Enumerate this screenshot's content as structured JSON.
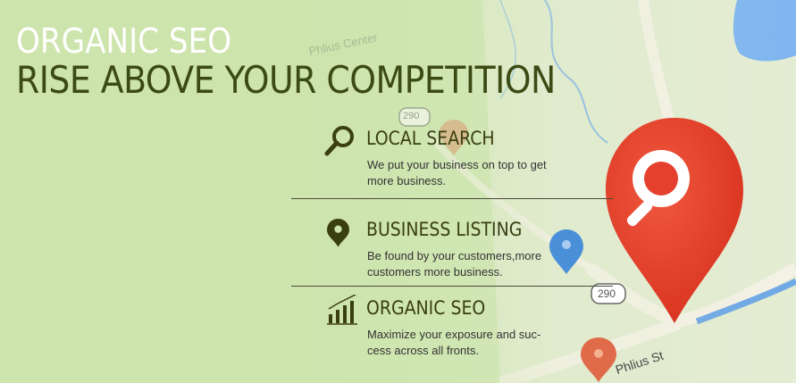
{
  "banner": {
    "title_line1": "ORGANIC SEO",
    "title_line2": "RISE ABOVE YOUR COMPETITION"
  },
  "features": [
    {
      "icon": "magnifier-icon",
      "title": "LOCAL SEARCH",
      "desc": "We put your business on top to get more business."
    },
    {
      "icon": "map-pin-icon",
      "title": "BUSINESS LISTING",
      "desc": "Be found by your customers,more customers more business."
    },
    {
      "icon": "bar-chart-icon",
      "title": "ORGANIC SEO",
      "desc": "Maximize your exposure and suc- cess across all fronts."
    }
  ],
  "map": {
    "road_shield_1": "290",
    "road_shield_2": "290",
    "street_fragment": "Phlius St",
    "place_fragment": "Phlius Center",
    "colors": {
      "bg_green": "#cfe6b0",
      "water": "#7fb6f0",
      "road": "#f3f1e8",
      "pin_red": "#e5402e",
      "pin_blue": "#4a90d9",
      "pin_orange": "#e06b4a"
    }
  }
}
